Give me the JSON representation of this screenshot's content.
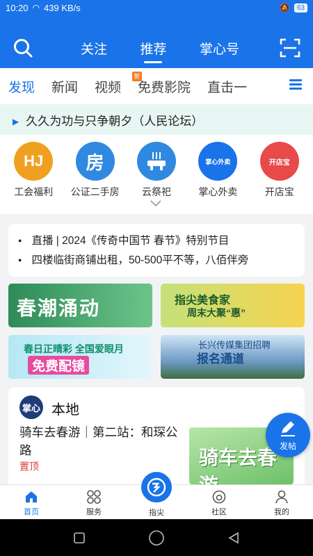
{
  "status_bar": {
    "time": "10:20",
    "network_speed": "439 KB/s",
    "battery": "63"
  },
  "header": {
    "tabs": [
      {
        "label": "关注"
      },
      {
        "label": "推荐",
        "active": true
      },
      {
        "label": "掌心号"
      }
    ],
    "icons": [
      "search-icon",
      "scan-icon"
    ]
  },
  "categories": [
    {
      "label": "发现",
      "active": true
    },
    {
      "label": "新闻"
    },
    {
      "label": "视频"
    },
    {
      "label": "免费影院",
      "badge": "新"
    },
    {
      "label": "直击一"
    }
  ],
  "marquee": {
    "text": "久久为功与只争朝夕（人民论坛）"
  },
  "services": [
    {
      "label": "工会福利",
      "icon": "gift-icon",
      "glyph": "HJ",
      "color": "#f0a020"
    },
    {
      "label": "公证二手房",
      "icon": "house-icon",
      "glyph": "房",
      "color": "#2f89e0"
    },
    {
      "label": "云祭祀",
      "icon": "incense-burner-icon",
      "glyph": "",
      "color": "#2f89e0"
    },
    {
      "label": "掌心外卖",
      "icon": "takeaway-bag-icon",
      "glyph": "掌心外卖",
      "color": "#1a73e8"
    },
    {
      "label": "开店宝",
      "icon": "shop-icon",
      "glyph": "开店宝",
      "color": "#e84a4a"
    }
  ],
  "headlines": [
    "直播 | 2024《传奇中国节 春节》特别节目",
    "四楼临街商铺出租，50-500平不等，八佰伴旁"
  ],
  "banners": {
    "b1": {
      "title": "春潮涌动"
    },
    "b2": {
      "title": "指尖美食家",
      "subtitle": "周末大聚“惠”"
    },
    "b3": {
      "title": "春日正晴彩 全国爱眼月",
      "subtitle": "免费配镜"
    },
    "b4": {
      "title": "长兴传媒集团招聘",
      "subtitle": "报名通道"
    }
  },
  "local": {
    "logo": "掌心",
    "title": "本地",
    "article_title": "骑车去春游｜第二站：和琛公路",
    "pinned": "置顶",
    "thumb_text": "骑车去春游"
  },
  "fab": {
    "label": "发帖"
  },
  "bottom_nav": [
    {
      "label": "首页",
      "icon": "home-icon",
      "active": true
    },
    {
      "label": "服务",
      "icon": "services-icon"
    },
    {
      "label": "指尖",
      "icon": "fingertip-logo-icon"
    },
    {
      "label": "社区",
      "icon": "community-icon"
    },
    {
      "label": "我的",
      "icon": "profile-icon"
    }
  ],
  "colors": {
    "brand": "#1a73e8",
    "marquee_bg": "#e8f6f3",
    "pinned": "#e03a3a"
  }
}
